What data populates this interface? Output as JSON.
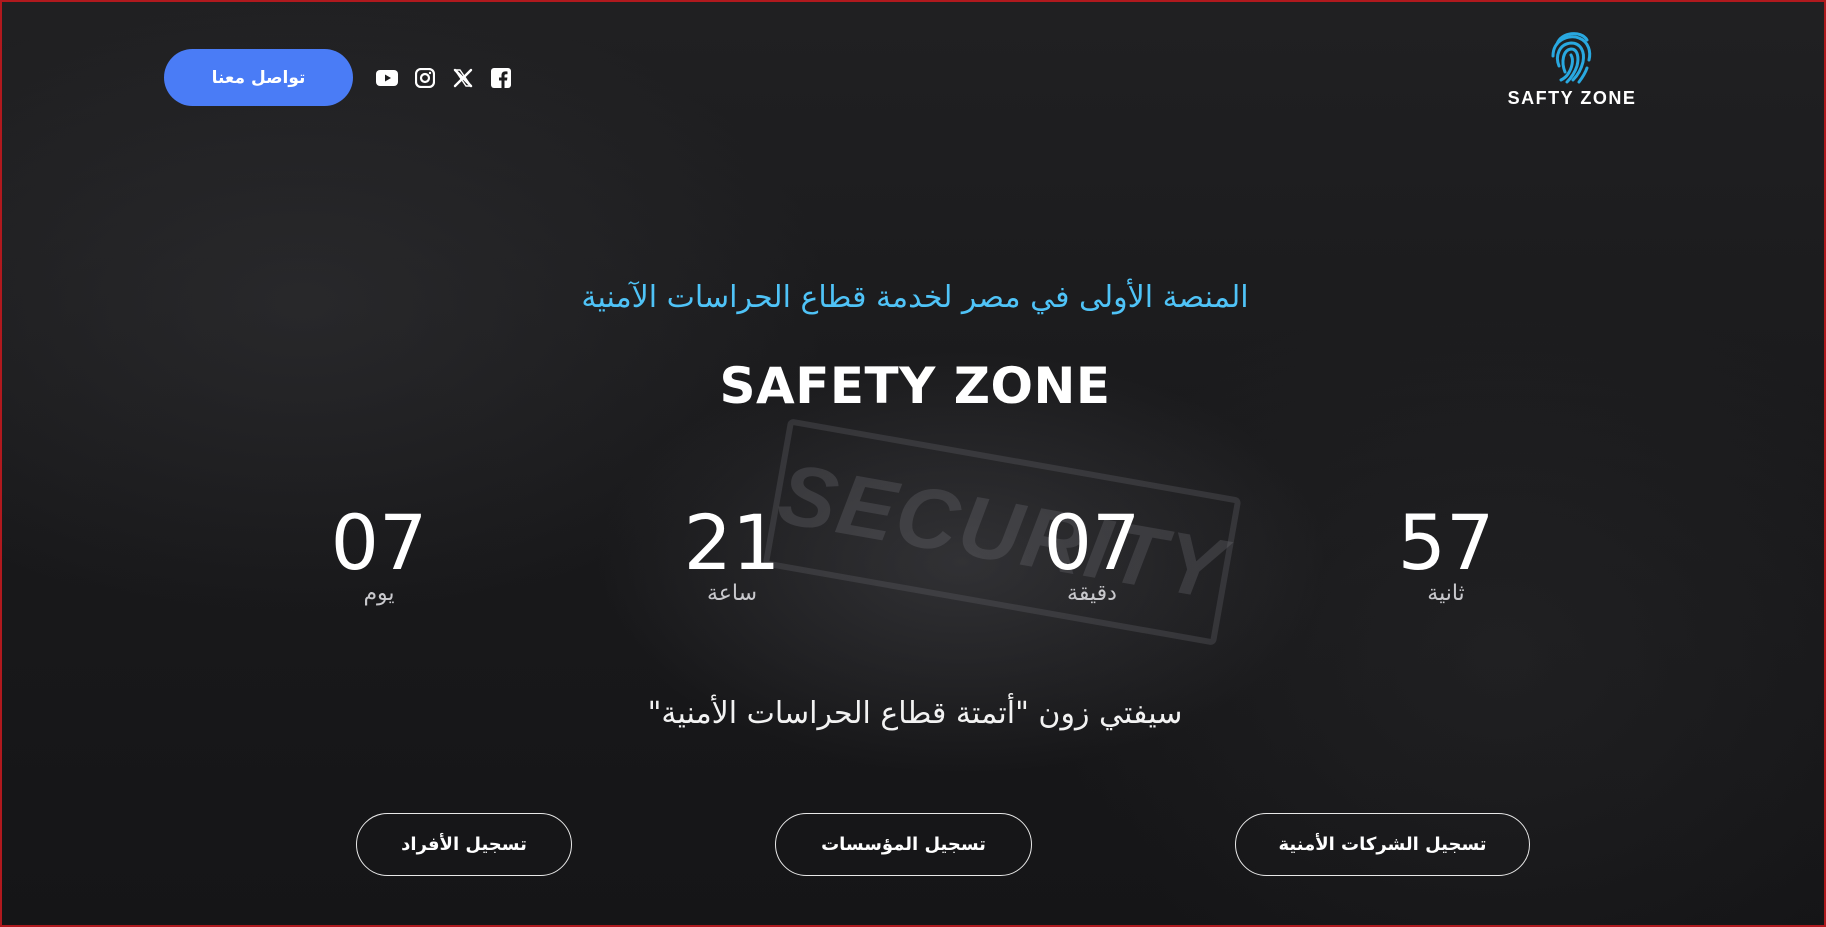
{
  "header": {
    "logo_text": "SAFTY ZONE",
    "contact_label": "تواصل معنا",
    "socials": [
      {
        "icon": "youtube-icon"
      },
      {
        "icon": "instagram-icon"
      },
      {
        "icon": "x-icon"
      },
      {
        "icon": "facebook-icon"
      }
    ]
  },
  "background": {
    "patch_text": "SECURITY"
  },
  "hero": {
    "tagline": "المنصة الأولى في مصر لخدمة قطاع الحراسات الآمنية",
    "title": "SAFETY ZONE",
    "slogan": "سيفتي زون \"أتمتة قطاع الحراسات الأمنية\""
  },
  "countdown": {
    "days": {
      "value": "07",
      "label": "يوم"
    },
    "hours": {
      "value": "21",
      "label": "ساعة"
    },
    "minutes": {
      "value": "07",
      "label": "دقيقة"
    },
    "seconds": {
      "value": "57",
      "label": "ثانية"
    }
  },
  "registration": {
    "individuals": "تسجيل الأفراد",
    "institutions": "تسجيل المؤسسات",
    "companies": "تسجيل الشركات الأمنية"
  },
  "colors": {
    "accent_blue": "#4a7cf6",
    "tagline_cyan": "#4fc3f7",
    "border_red": "#b0191e"
  }
}
